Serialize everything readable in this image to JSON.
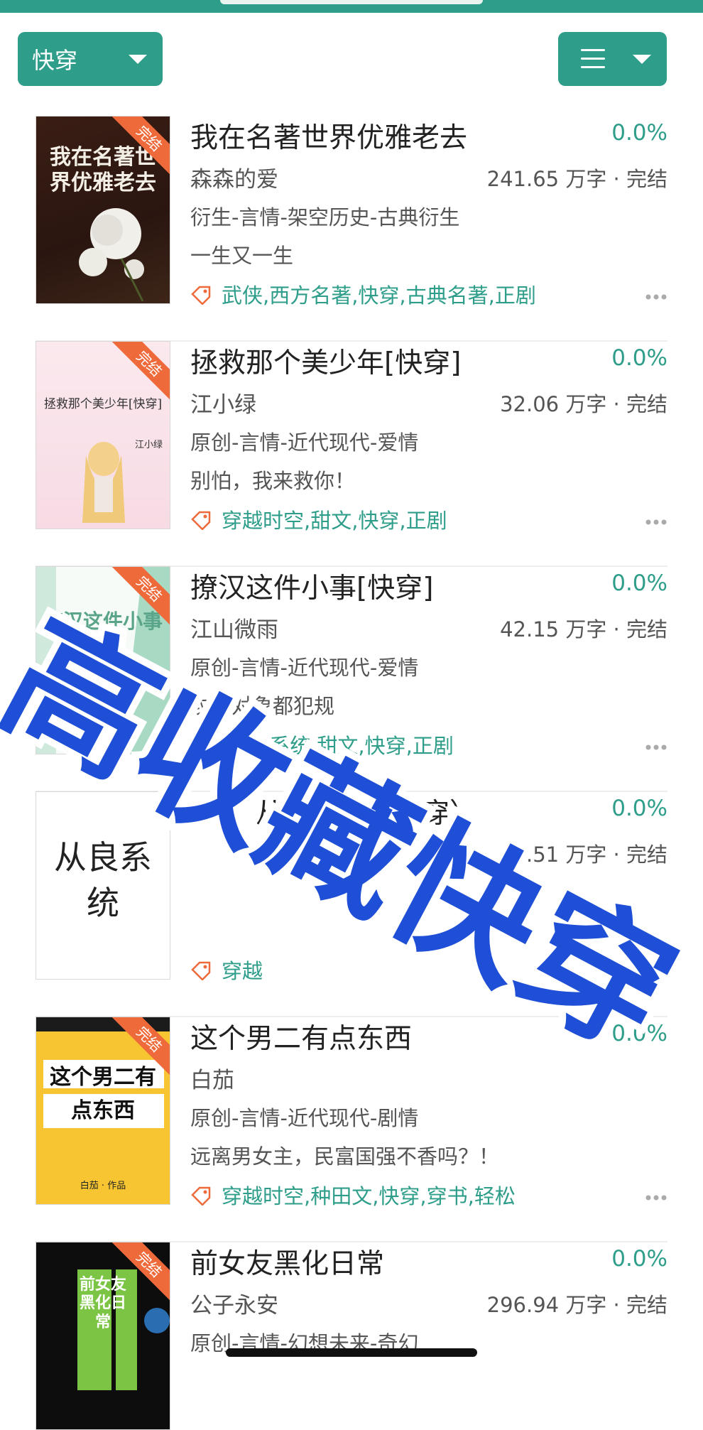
{
  "filter": {
    "category": "快穿"
  },
  "colors": {
    "accent": "#2e9e8a",
    "badge": "#ef6a3a",
    "watermark_fill": "#1f4fd6"
  },
  "books": [
    {
      "title": "我在名著世界优雅老去",
      "progress": "0.0%",
      "author": "森森的爱",
      "words": "241.65 万字 · 完结",
      "genre": "衍生-言情-架空历史-古典衍生",
      "intro": "一生又一生",
      "tags": "武侠,西方名著,快穿,古典名著,正剧",
      "badge": "完结",
      "cover_text": "我在名著世界优雅老去"
    },
    {
      "title": "拯救那个美少年[快穿]",
      "progress": "0.0%",
      "author": "江小绿",
      "words": "32.06 万字 · 完结",
      "genre": "原创-言情-近代现代-爱情",
      "intro": "别怕，我来救你！",
      "tags": "穿越时空,甜文,快穿,正剧",
      "badge": "完结",
      "cover_text": "拯救那个美少年[快穿]",
      "cover_author": "江小绿"
    },
    {
      "title": "撩汉这件小事[快穿]",
      "progress": "0.0%",
      "author": "江山微雨",
      "words": "42.15 万字 · 完结",
      "genre": "原创-言情-近代现代-爱情",
      "intro": "攻略对象都犯规",
      "tags": "女配,系统,甜文,快穿,正剧",
      "badge": "完结",
      "cover_text": "撩汉这件小事",
      "cover_sub": "-快穿-"
    },
    {
      "title": "从良系统（快穿）",
      "progress": "0.0%",
      "author": "",
      "words": "49.51 万字 · 完结",
      "genre": "",
      "intro": "",
      "tags": "穿越",
      "badge": "",
      "cover_text": "从良系统"
    },
    {
      "title": "这个男二有点东西",
      "progress": "0.0%",
      "author": "白茄",
      "words": "",
      "genre": "原创-言情-近代现代-剧情",
      "intro": "远离男女主，民富国强不香吗？！",
      "tags": "穿越时空,种田文,快穿,穿书,轻松",
      "badge": "完结",
      "cover_text": "这个男二有点东西",
      "cover_author": "白茄 · 作品"
    },
    {
      "title": "前女友黑化日常",
      "progress": "0.0%",
      "author": "公子永安",
      "words": "296.94 万字 · 完结",
      "genre": "原创-言情-幻想未来-奇幻",
      "intro": "",
      "tags": "",
      "badge": "完结",
      "cover_text": "前女友黑化日常"
    }
  ],
  "overlay": {
    "text": "高收藏快穿"
  },
  "icons": {
    "tag": "tag-icon",
    "more": "more-dots-icon",
    "menu": "menu-icon",
    "caret": "caret-down-icon"
  }
}
